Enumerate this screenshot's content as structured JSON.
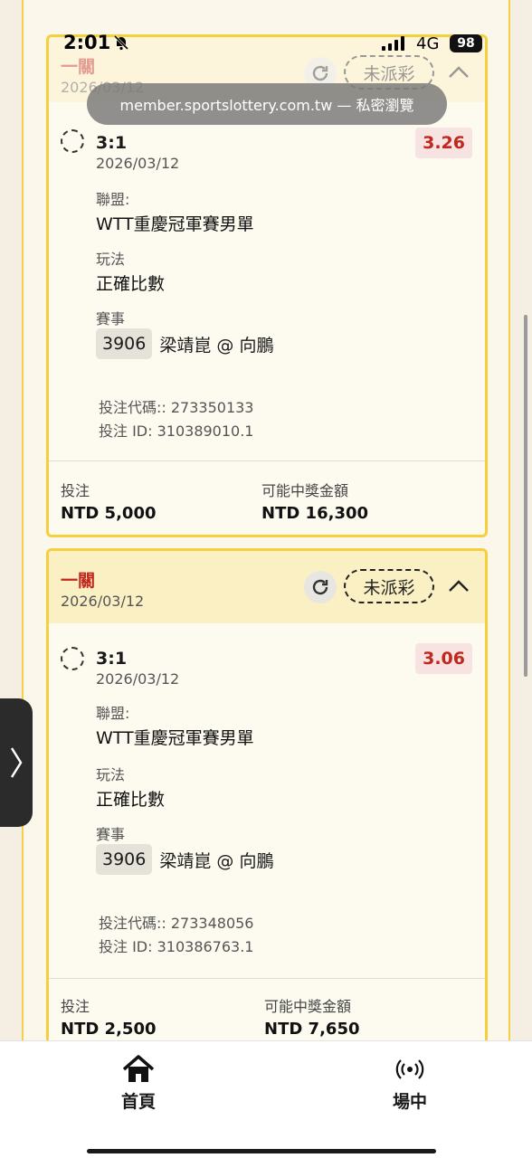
{
  "status_bar": {
    "time": "2:01",
    "network": "4G",
    "battery": "98"
  },
  "browser": {
    "url": "member.sportslottery.com.tw — 私密瀏覽"
  },
  "bets": [
    {
      "leg_title": "一關",
      "leg_date": "2026/03/12",
      "status": "未派彩",
      "score": "3:1",
      "selection_date": "2026/03/12",
      "odds": "3.26",
      "league_label": "聯盟:",
      "league": "WTT重慶冠軍賽男單",
      "market_label": "玩法",
      "market": "正確比數",
      "event_label": "賽事",
      "event_id": "3906",
      "event_name": "梁靖崑 @ 向鵬",
      "bet_code": "投注代碼:: 273350133",
      "bet_id": "投注 ID: 310389010.1",
      "stake_label": "投注",
      "stake": "NTD 5,000",
      "payout_label": "可能中獎金額",
      "payout": "NTD 16,300"
    },
    {
      "leg_title": "一關",
      "leg_date": "2026/03/12",
      "status": "未派彩",
      "score": "3:1",
      "selection_date": "2026/03/12",
      "odds": "3.06",
      "league_label": "聯盟:",
      "league": "WTT重慶冠軍賽男單",
      "market_label": "玩法",
      "market": "正確比數",
      "event_label": "賽事",
      "event_id": "3906",
      "event_name": "梁靖崑 @ 向鵬",
      "bet_code": "投注代碼:: 273348056",
      "bet_id": "投注 ID: 310386763.1",
      "stake_label": "投注",
      "stake": "NTD 2,500",
      "payout_label": "可能中獎金額",
      "payout": "NTD 7,650"
    }
  ],
  "bottom_nav": {
    "home": "首頁",
    "live": "場中"
  },
  "colors": {
    "accent": "#f5d03c",
    "odds": "#c0281e",
    "header_bg": "#fbf0c4"
  }
}
